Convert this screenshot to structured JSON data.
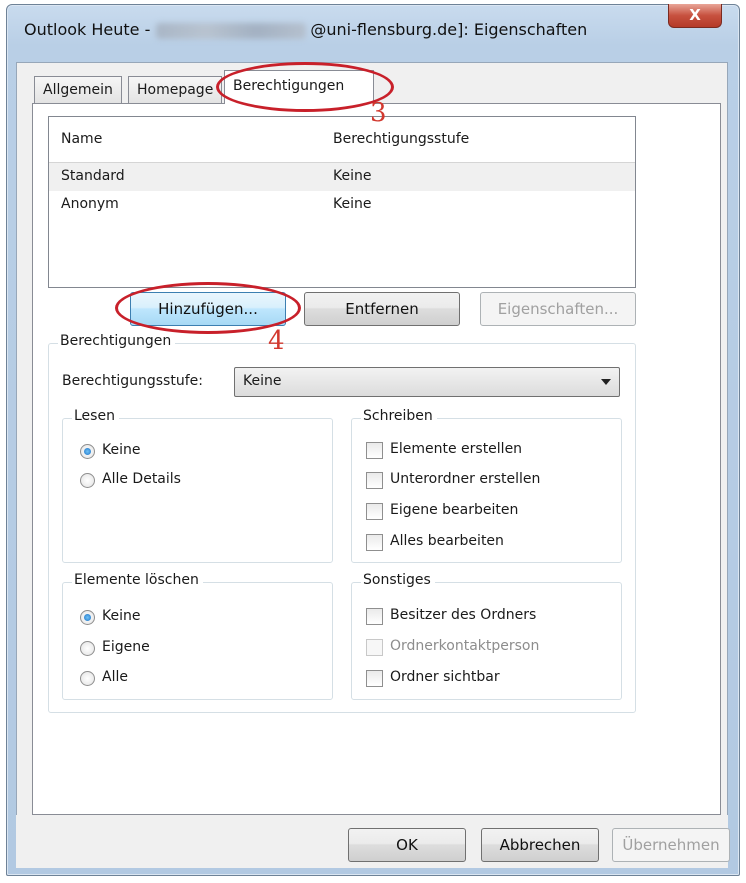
{
  "window": {
    "title_prefix": "Outlook Heute -",
    "title_suffix": "@uni-flensburg.de]: Eigenschaften",
    "close_glyph": "X"
  },
  "tabs": [
    {
      "label": "Allgemein"
    },
    {
      "label": "Homepage"
    },
    {
      "label": "Berechtigungen",
      "active": true
    }
  ],
  "list": {
    "columns": [
      "Name",
      "Berechtigungsstufe"
    ],
    "rows": [
      {
        "name": "Standard",
        "level": "Keine",
        "selected": true
      },
      {
        "name": "Anonym",
        "level": "Keine"
      }
    ]
  },
  "list_buttons": {
    "add": "Hinzufügen...",
    "remove": "Entfernen",
    "properties": "Eigenschaften..."
  },
  "permissions": {
    "caption": "Berechtigungen",
    "level_label": "Berechtigungsstufe:",
    "level_value": "Keine",
    "read": {
      "caption": "Lesen",
      "options": [
        {
          "label": "Keine",
          "selected": true
        },
        {
          "label": "Alle Details",
          "selected": false
        }
      ]
    },
    "write": {
      "caption": "Schreiben",
      "options": [
        {
          "label": "Elemente erstellen",
          "checked": false
        },
        {
          "label": "Unterordner erstellen",
          "checked": false
        },
        {
          "label": "Eigene bearbeiten",
          "checked": false
        },
        {
          "label": "Alles bearbeiten",
          "checked": false
        }
      ]
    },
    "delete": {
      "caption": "Elemente löschen",
      "options": [
        {
          "label": "Keine",
          "selected": true
        },
        {
          "label": "Eigene",
          "selected": false
        },
        {
          "label": "Alle",
          "selected": false
        }
      ]
    },
    "other": {
      "caption": "Sonstiges",
      "options": [
        {
          "label": "Besitzer des Ordners",
          "checked": false
        },
        {
          "label": "Ordnerkontaktperson",
          "checked": false,
          "disabled": true
        },
        {
          "label": "Ordner sichtbar",
          "checked": false
        }
      ]
    }
  },
  "dialog_buttons": {
    "ok": "OK",
    "cancel": "Abbrechen",
    "apply": "Übernehmen"
  },
  "annotations": {
    "step_tab": "3",
    "step_add": "4",
    "color": "#c8202a"
  }
}
